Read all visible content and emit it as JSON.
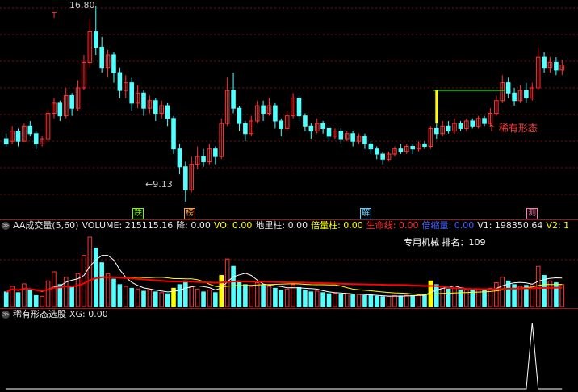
{
  "colors": {
    "up": "#ff3232",
    "down": "#54ffff",
    "bg": "#000000",
    "grid": "#7a1010",
    "ma_white": "#ffffff",
    "ma_yellow": "#ffff00",
    "life_line": "#ff0000",
    "green_line": "#00ff00"
  },
  "price_panel": {
    "high_label": "16.80",
    "low_label": "←9.13",
    "annotation": "↑ 稀有形态",
    "tags": [
      {
        "text": "跌",
        "color": "#7cfc00"
      },
      {
        "text": "榜",
        "color": "#ffa040"
      },
      {
        "text": "解",
        "color": "#6fd3ff"
      },
      {
        "text": "测",
        "color": "#ff7ab0"
      }
    ],
    "t_marker": "T"
  },
  "volume_panel": {
    "collapse_icon": "≫",
    "indicator_name": "AA成交量(5,60)",
    "fields": [
      {
        "label": "VOLUME: 215115.16",
        "color": "#e6e6e6"
      },
      {
        "label": "降: 0.00",
        "color": "#e6e6e6"
      },
      {
        "label": "VO: 0.00",
        "color": "#ffff00"
      },
      {
        "label": "地里柱: 0.00",
        "color": "#e6e6e6"
      },
      {
        "label": "倍量柱: 0.00",
        "color": "#ffff00"
      },
      {
        "label": "生命线: 0.00",
        "color": "#ff3030"
      },
      {
        "label": "倍缩量: 0.00",
        "color": "#4060ff"
      },
      {
        "label": "V1: 198350.64",
        "color": "#e6e6e6"
      },
      {
        "label": "V2: 1",
        "color": "#ffff00"
      }
    ],
    "ranking": "专用机械    排名：109"
  },
  "indicator_panel": {
    "collapse_icon": "≫",
    "indicator_name": "稀有形态选股",
    "fields": [
      {
        "label": "XG: 0.00",
        "color": "#e6e6e6"
      }
    ]
  },
  "chart_data": {
    "type": "candlestick",
    "price_max": 16.8,
    "price_min": 9.13,
    "candles": [
      [
        11.6,
        11.4,
        11.8,
        11.3
      ],
      [
        11.5,
        11.9,
        12.1,
        11.4
      ],
      [
        11.9,
        11.5,
        12.0,
        11.3
      ],
      [
        11.5,
        12.1,
        12.2,
        11.5
      ],
      [
        12.1,
        11.8,
        12.3,
        11.7
      ],
      [
        11.8,
        11.4,
        11.9,
        11.2
      ],
      [
        11.4,
        11.6,
        11.7,
        11.3
      ],
      [
        11.6,
        12.6,
        12.7,
        11.5
      ],
      [
        12.6,
        13.0,
        13.2,
        12.4
      ],
      [
        13.0,
        12.5,
        13.1,
        12.3
      ],
      [
        12.5,
        13.3,
        13.6,
        12.4
      ],
      [
        13.3,
        12.8,
        13.4,
        12.5
      ],
      [
        12.8,
        13.6,
        13.9,
        12.7
      ],
      [
        13.6,
        14.6,
        14.9,
        13.5
      ],
      [
        14.6,
        15.8,
        16.3,
        14.4
      ],
      [
        15.8,
        15.2,
        16.8,
        14.9
      ],
      [
        15.2,
        14.4,
        15.6,
        14.2
      ],
      [
        14.4,
        14.9,
        15.1,
        14.0
      ],
      [
        14.9,
        14.2,
        15.0,
        13.8
      ],
      [
        14.2,
        13.5,
        14.4,
        13.2
      ],
      [
        13.5,
        13.8,
        14.1,
        13.2
      ],
      [
        13.8,
        13.0,
        14.0,
        12.7
      ],
      [
        13.0,
        13.4,
        13.7,
        12.8
      ],
      [
        13.4,
        12.8,
        13.5,
        12.5
      ],
      [
        12.8,
        13.1,
        13.3,
        12.6
      ],
      [
        13.1,
        12.6,
        13.2,
        12.3
      ],
      [
        12.6,
        12.9,
        13.1,
        12.4
      ],
      [
        12.9,
        12.4,
        13.0,
        12.1
      ],
      [
        12.4,
        11.2,
        12.5,
        11.0
      ],
      [
        11.2,
        10.5,
        11.4,
        10.2
      ],
      [
        10.5,
        9.6,
        10.7,
        9.13
      ],
      [
        9.6,
        10.6,
        10.9,
        9.5
      ],
      [
        10.6,
        10.9,
        11.3,
        10.4
      ],
      [
        10.9,
        10.7,
        11.2,
        10.5
      ],
      [
        10.7,
        11.2,
        11.4,
        10.6
      ],
      [
        11.2,
        10.9,
        11.3,
        10.6
      ],
      [
        10.9,
        12.2,
        12.4,
        10.8
      ],
      [
        12.2,
        13.5,
        14.0,
        12.1
      ],
      [
        13.5,
        12.8,
        14.2,
        12.6
      ],
      [
        12.8,
        12.2,
        12.9,
        11.9
      ],
      [
        12.2,
        11.8,
        12.3,
        11.5
      ],
      [
        11.8,
        12.3,
        12.5,
        11.7
      ],
      [
        12.3,
        12.9,
        13.1,
        12.2
      ],
      [
        12.9,
        12.6,
        13.1,
        12.3
      ],
      [
        12.6,
        12.9,
        13.2,
        12.5
      ],
      [
        12.9,
        12.3,
        13.0,
        12.0
      ],
      [
        12.3,
        12.0,
        12.4,
        11.7
      ],
      [
        12.0,
        12.5,
        12.7,
        11.9
      ],
      [
        12.5,
        13.2,
        13.4,
        12.4
      ],
      [
        13.2,
        12.5,
        13.3,
        12.3
      ],
      [
        12.5,
        12.1,
        12.6,
        11.9
      ],
      [
        12.1,
        11.9,
        12.2,
        11.6
      ],
      [
        11.9,
        12.2,
        12.4,
        11.8
      ],
      [
        12.2,
        12.0,
        12.3,
        11.8
      ],
      [
        12.0,
        11.7,
        12.1,
        11.5
      ],
      [
        11.7,
        11.9,
        12.0,
        11.6
      ],
      [
        11.9,
        11.6,
        12.0,
        11.4
      ],
      [
        11.6,
        11.8,
        11.9,
        11.5
      ],
      [
        11.8,
        11.5,
        11.9,
        11.3
      ],
      [
        11.5,
        11.7,
        11.8,
        11.4
      ],
      [
        11.7,
        11.4,
        11.8,
        11.2
      ],
      [
        11.4,
        11.2,
        11.5,
        11.0
      ],
      [
        11.2,
        11.0,
        11.3,
        10.8
      ],
      [
        11.0,
        10.8,
        11.1,
        10.6
      ],
      [
        10.8,
        11.0,
        11.1,
        10.7
      ],
      [
        11.0,
        11.2,
        11.3,
        10.9
      ],
      [
        11.2,
        11.1,
        11.4,
        11.0
      ],
      [
        11.1,
        11.3,
        11.4,
        11.0
      ],
      [
        11.3,
        11.2,
        11.4,
        11.0
      ],
      [
        11.2,
        11.4,
        11.5,
        11.1
      ],
      [
        11.4,
        11.3,
        11.5,
        11.2
      ],
      [
        11.3,
        12.0,
        12.1,
        11.2
      ],
      [
        12.0,
        11.8,
        12.2,
        11.6
      ],
      [
        11.8,
        12.1,
        12.3,
        11.7
      ],
      [
        12.1,
        11.9,
        12.3,
        11.8
      ],
      [
        11.9,
        12.2,
        12.4,
        11.8
      ],
      [
        12.2,
        12.0,
        12.3,
        11.9
      ],
      [
        12.0,
        12.3,
        12.4,
        11.9
      ],
      [
        12.3,
        12.1,
        12.4,
        12.0
      ],
      [
        12.1,
        12.4,
        12.5,
        12.0
      ],
      [
        12.4,
        12.2,
        12.5,
        12.1
      ],
      [
        12.2,
        12.6,
        12.8,
        12.1
      ],
      [
        12.6,
        13.1,
        13.3,
        12.5
      ],
      [
        13.1,
        13.8,
        14.1,
        13.0
      ],
      [
        13.8,
        13.4,
        14.0,
        13.2
      ],
      [
        13.4,
        13.1,
        13.6,
        12.9
      ],
      [
        13.1,
        13.5,
        13.7,
        13.0
      ],
      [
        13.5,
        13.2,
        13.8,
        13.0
      ],
      [
        13.2,
        13.6,
        13.8,
        13.1
      ],
      [
        13.6,
        14.8,
        15.2,
        13.5
      ],
      [
        14.8,
        14.4,
        15.0,
        14.2
      ],
      [
        14.4,
        14.6,
        14.8,
        14.2
      ],
      [
        14.6,
        14.3,
        14.8,
        14.1
      ],
      [
        14.3,
        14.5,
        14.7,
        14.1
      ]
    ],
    "volume": [
      40,
      55,
      38,
      62,
      45,
      30,
      28,
      70,
      95,
      60,
      80,
      55,
      90,
      140,
      190,
      160,
      120,
      90,
      75,
      60,
      55,
      50,
      48,
      42,
      45,
      40,
      38,
      35,
      50,
      60,
      70,
      55,
      48,
      40,
      45,
      38,
      85,
      130,
      110,
      70,
      60,
      55,
      65,
      58,
      55,
      50,
      45,
      48,
      60,
      52,
      45,
      40,
      42,
      38,
      35,
      36,
      34,
      35,
      32,
      33,
      30,
      30,
      28,
      27,
      28,
      30,
      29,
      31,
      30,
      32,
      31,
      70,
      60,
      55,
      48,
      50,
      45,
      46,
      44,
      45,
      43,
      50,
      65,
      80,
      70,
      60,
      55,
      58,
      62,
      110,
      85,
      70,
      65,
      60
    ],
    "xg_values": [
      0,
      0,
      0,
      0,
      0,
      0,
      0,
      0,
      0,
      0,
      0,
      0,
      0,
      0,
      0,
      0,
      0,
      0,
      0,
      0,
      0,
      0,
      0,
      0,
      0,
      0,
      0,
      0,
      0,
      0,
      0,
      0,
      0,
      0,
      0,
      0,
      0,
      0,
      0,
      0,
      0,
      0,
      0,
      0,
      0,
      0,
      0,
      0,
      0,
      0,
      0,
      0,
      0,
      0,
      0,
      0,
      0,
      0,
      0,
      0,
      0,
      0,
      0,
      0,
      0,
      0,
      0,
      0,
      0,
      0,
      0,
      0,
      0,
      0,
      0,
      0,
      0,
      0,
      0,
      0,
      0,
      0,
      0,
      0,
      0,
      0,
      0,
      0,
      1,
      0,
      0,
      0,
      0,
      0
    ]
  }
}
